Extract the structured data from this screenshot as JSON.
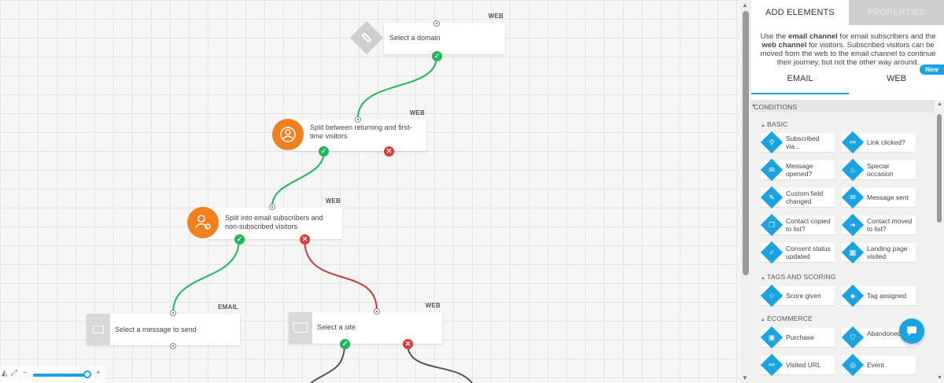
{
  "canvas": {
    "nodes": {
      "domain": {
        "tag": "WEB",
        "text": "Select a domain"
      },
      "split_returning": {
        "tag": "WEB",
        "text": "Split between returning and first-time visitors"
      },
      "split_subscribers": {
        "tag": "WEB",
        "text": "Split into email subscribers and non-subscribed visitors"
      },
      "email_message": {
        "tag": "EMAIL",
        "text": "Select a message to send"
      },
      "site": {
        "tag": "WEB",
        "text": "Select a site"
      }
    },
    "zoom": {
      "out": "−",
      "in": "+",
      "fit": "⤢",
      "center": "◭",
      "level": 0.9
    }
  },
  "panel": {
    "tabs": {
      "add_elements": "ADD ELEMENTS",
      "properties": "PROPERTIES"
    },
    "info": {
      "prefix": "Use the ",
      "email_channel": "email channel",
      "middle": " for email subscribers and the ",
      "web_channel": "web channel",
      "suffix": " for visitors. Subscribed visitors can be moved from the web to the email channel to continue their journey, but not the other way around."
    },
    "new_badge": "New",
    "channel_tabs": {
      "email": "EMAIL",
      "web": "WEB"
    },
    "sections": {
      "conditions": "CONDITIONS",
      "basic": "BASIC",
      "tags_scoring": "TAGS AND SCORING",
      "ecommerce": "ECOMMERCE"
    },
    "items": {
      "subscribed_via": "Subscribed via...",
      "link_clicked": "Link clicked?",
      "message_opened": "Message opened?",
      "special_occasion": "Special occasion",
      "custom_field_changed": "Custom field changed",
      "message_sent": "Message sent",
      "contact_copied": "Contact copied to list?",
      "contact_moved": "Contact moved to list?",
      "consent_status": "Consent status updated",
      "landing_page": "Landing page visited",
      "score_given": "Score given",
      "tag_assigned": "Tag assigned",
      "purchase": "Purchase",
      "abandoned_cart": "Abandoned cart",
      "visited_url": "Visited URL",
      "event": "Event"
    }
  },
  "colors": {
    "accent": "#1aa3e0",
    "success": "#1fb85a",
    "danger": "#e03b3b",
    "orange": "#f3801f"
  }
}
